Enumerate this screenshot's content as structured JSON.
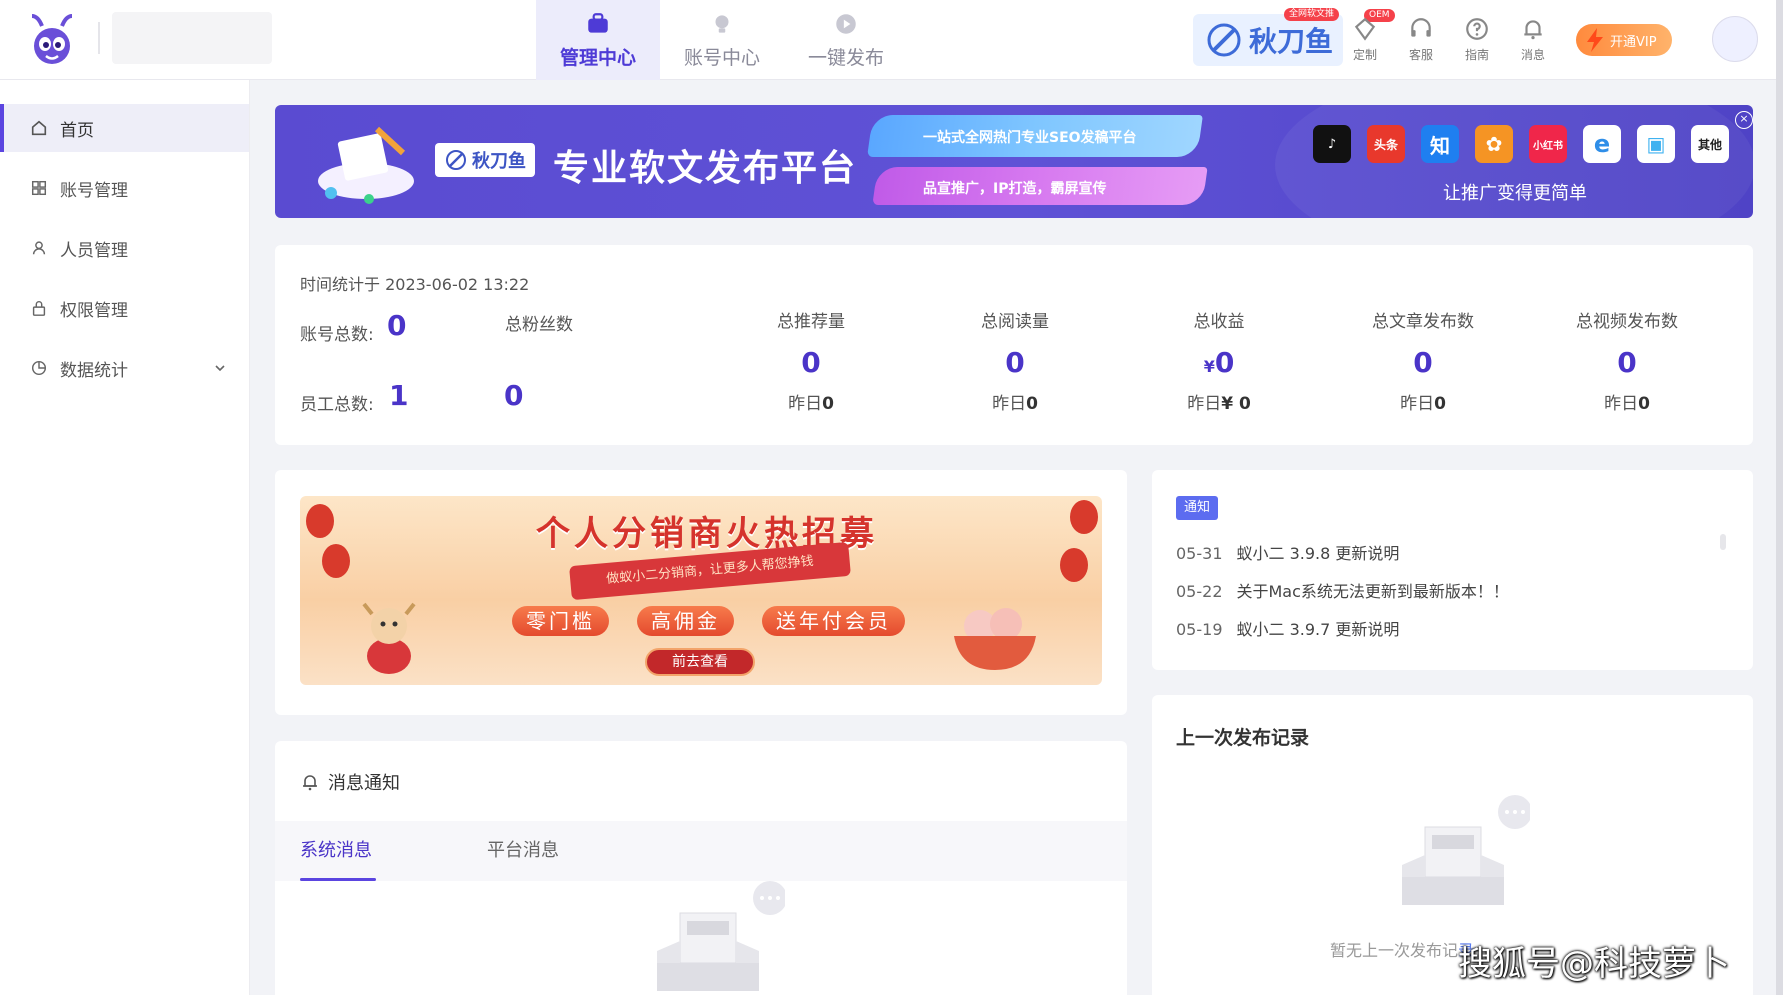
{
  "nav": {
    "tabs": [
      {
        "label": "管理中心",
        "active": true,
        "icon": "briefcase-icon"
      },
      {
        "label": "账号中心",
        "active": false,
        "icon": "bulb-icon"
      },
      {
        "label": "一键发布",
        "active": false,
        "icon": "play-icon"
      }
    ]
  },
  "header": {
    "brand_name": "秋刀鱼",
    "brand_badge": "全网软文推",
    "oem_badge": "OEM",
    "tools": [
      {
        "label": "定制",
        "icon": "diamond-icon"
      },
      {
        "label": "客服",
        "icon": "headset-icon"
      },
      {
        "label": "指南",
        "icon": "help-icon"
      },
      {
        "label": "消息",
        "icon": "bell-icon"
      }
    ],
    "vip_label": "开通VIP"
  },
  "sidebar": {
    "items": [
      {
        "label": "首页",
        "icon": "home-icon",
        "active": true
      },
      {
        "label": "账号管理",
        "icon": "grid-icon",
        "active": false
      },
      {
        "label": "人员管理",
        "icon": "user-icon",
        "active": false
      },
      {
        "label": "权限管理",
        "icon": "lock-icon",
        "active": false
      },
      {
        "label": "数据统计",
        "icon": "pie-icon",
        "active": false,
        "expandable": true
      }
    ]
  },
  "banner": {
    "logo_text": "秋刀鱼",
    "title": "专业软文发布平台",
    "line1": "一站式全网热门专业SEO发稿平台",
    "line2": "品宣推广，IP打造，霸屏宣传",
    "platforms": [
      {
        "label": "♪",
        "color": "#111111"
      },
      {
        "label": "头条",
        "color": "#e8382c"
      },
      {
        "label": "知",
        "color": "#1f7ff0"
      },
      {
        "label": "✿",
        "color": "#f59424"
      },
      {
        "label": "小红书",
        "color": "#f0264a"
      },
      {
        "label": "e",
        "color": "#2f8ee8"
      },
      {
        "label": "▣",
        "color": "#3fb2f0"
      },
      {
        "label": "其他",
        "color": "#ffffff"
      }
    ],
    "subtitle": "让推广变得更简单",
    "close": "×"
  },
  "stats": {
    "time_label": "时间统计于 2023-06-02 13:22",
    "accounts_label": "账号总数:",
    "accounts_value": "0",
    "staff_label": "员工总数:",
    "staff_value": "1",
    "fans_label": "总粉丝数",
    "fans_value": "0",
    "columns": [
      {
        "label": "总推荐量",
        "value": "0",
        "prefix": "",
        "yesterday_label": "昨日",
        "yesterday_value": "0"
      },
      {
        "label": "总阅读量",
        "value": "0",
        "prefix": "",
        "yesterday_label": "昨日",
        "yesterday_value": "0"
      },
      {
        "label": "总收益",
        "value": "0",
        "prefix": "¥",
        "yesterday_label": "昨日",
        "yesterday_value": "¥ 0"
      },
      {
        "label": "总文章发布数",
        "value": "0",
        "prefix": "",
        "yesterday_label": "昨日",
        "yesterday_value": "0"
      },
      {
        "label": "总视频发布数",
        "value": "0",
        "prefix": "",
        "yesterday_label": "昨日",
        "yesterday_value": "0"
      }
    ]
  },
  "promo": {
    "title": "个人分销商火热招募",
    "ribbon": "做蚁小二分销商，让更多人帮您挣钱",
    "chips": [
      "零门槛",
      "高佣金",
      "送年付会员"
    ],
    "button": "前去查看"
  },
  "notice": {
    "tag": "通知",
    "items": [
      {
        "date": "05-31",
        "text": "蚁小二 3.9.8 更新说明"
      },
      {
        "date": "05-22",
        "text": "关于Mac系统无法更新到最新版本！！"
      },
      {
        "date": "05-19",
        "text": "蚁小二 3.9.7 更新说明"
      }
    ]
  },
  "messages": {
    "title": "消息通知",
    "tabs": [
      {
        "label": "系统消息",
        "active": true
      },
      {
        "label": "平台消息",
        "active": false
      }
    ]
  },
  "last_publish": {
    "title": "上一次发布记录",
    "empty_text": "暂无上一次发布记",
    "link_text": "录"
  },
  "watermark": "搜狐号@科技萝卜",
  "colors": {
    "accent": "#4a34c8",
    "accent_bar": "#5b45e0",
    "banner": "#5a4bd1"
  }
}
